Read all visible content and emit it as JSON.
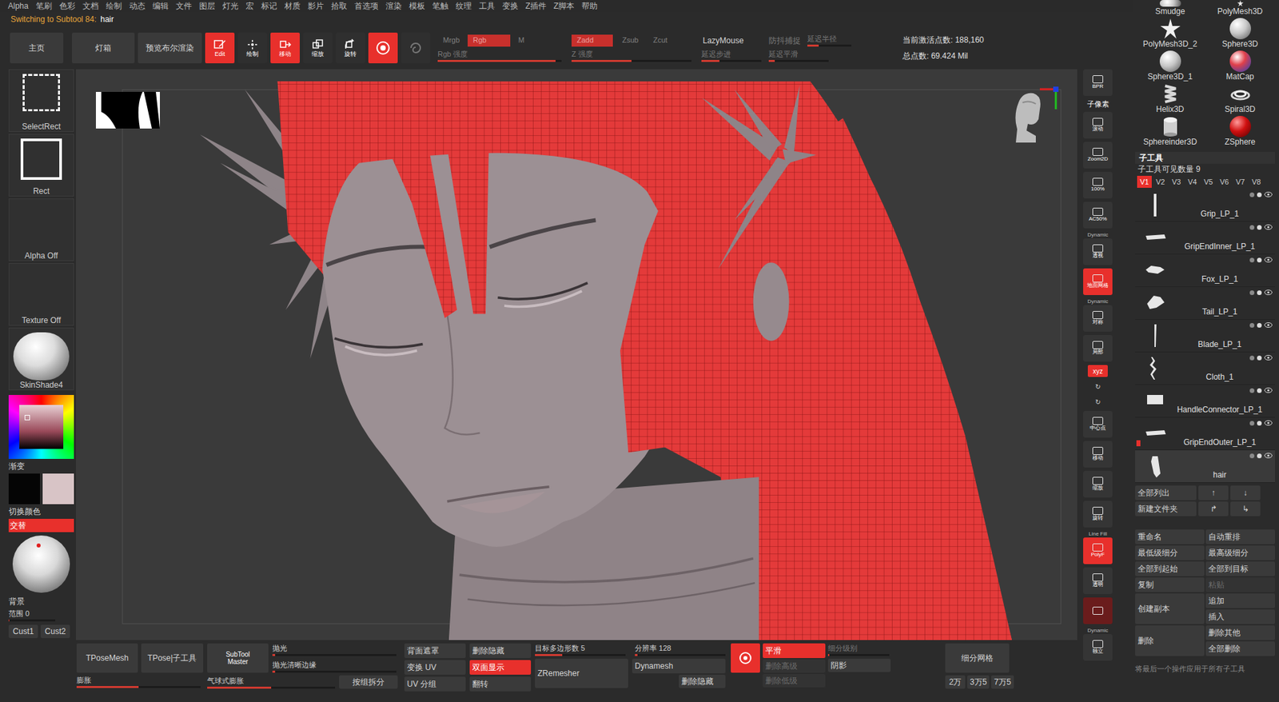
{
  "menu": [
    "Alpha",
    "笔刷",
    "色彩",
    "文档",
    "绘制",
    "动态",
    "编辑",
    "文件",
    "图层",
    "灯光",
    "宏",
    "标记",
    "材质",
    "影片",
    "拾取",
    "首选项",
    "渲染",
    "模板",
    "笔触",
    "纹理",
    "工具",
    "变换",
    "Z插件",
    "Z脚本",
    "帮助"
  ],
  "status": {
    "prefix": "Switching to Subtool 84:",
    "subtool": "hair"
  },
  "shelf": {
    "nav": [
      "主页",
      "灯箱",
      "预览布尔渲染"
    ],
    "modes": [
      {
        "label": "Edit",
        "kind": "edit",
        "selected": true
      },
      {
        "label": "绘制",
        "kind": "draw",
        "selected": false
      },
      {
        "label": "移动",
        "kind": "move",
        "selected": true
      },
      {
        "label": "缩放",
        "kind": "scale",
        "selected": false
      },
      {
        "label": "旋转",
        "kind": "rotate",
        "selected": false
      }
    ],
    "extras": [
      {
        "kind": "ring",
        "on": true
      },
      {
        "kind": "swirl",
        "on": false
      }
    ],
    "color_modes": [
      {
        "label": "Mrgb",
        "on": false
      },
      {
        "label": "Rgb",
        "on": true
      },
      {
        "label": "M",
        "on": false
      }
    ],
    "rgb_intensity": {
      "label": "Rgb 强度",
      "level": 0.95,
      "disabled": true
    },
    "z_modes": [
      {
        "label": "Zadd",
        "on": true
      },
      {
        "label": "Zsub",
        "on": false
      },
      {
        "label": "Zcut",
        "on": false
      }
    ],
    "z_intensity": {
      "label": "Z 强度",
      "level": 0.5,
      "disabled": true
    },
    "lazy": {
      "label": "LazyMouse",
      "on": false
    },
    "lazy_step": {
      "label": "延迟步进",
      "level": 0.3,
      "disabled": true
    },
    "snap": {
      "label": "防抖捕捉",
      "disabled": true
    },
    "lazy_radius": {
      "label": "延迟半径",
      "level": 0.25,
      "disabled": true
    },
    "lazy_smooth": {
      "label": "延迟平滑",
      "level": 0.1,
      "disabled": true
    },
    "active_points": "当前激活点数: 188,160",
    "total_points": "总点数: 69.424 Mil"
  },
  "left": {
    "tiles": [
      {
        "label": "SelectRect",
        "kind": "select"
      },
      {
        "label": "Rect",
        "kind": "rect"
      },
      {
        "label": "Alpha Off",
        "kind": "empty"
      },
      {
        "label": "Texture Off",
        "kind": "empty"
      },
      {
        "label": "SkinShade4",
        "kind": "material"
      }
    ],
    "gradient": "渐变",
    "swatches": [
      {
        "color": "#050505"
      },
      {
        "color": "#d8c4c6"
      }
    ],
    "switch": "切换颜色",
    "alternate": {
      "label": "交替",
      "on": true
    },
    "background": "背景",
    "range": {
      "label": "范围 0",
      "level": 0.0
    },
    "custom": [
      "Cust1",
      "Cust2"
    ]
  },
  "viewbar": [
    {
      "label": "BPR",
      "kind": "icon",
      "on": false
    },
    {
      "label": "子像素",
      "kind": "caption",
      "on": false
    },
    {
      "label": "滚动",
      "kind": "icon",
      "on": false
    },
    {
      "label": "Zoom2D",
      "kind": "icon",
      "on": false
    },
    {
      "label": "100%",
      "kind": "icon",
      "on": false
    },
    {
      "label": "AC50%",
      "kind": "icon",
      "on": false
    },
    {
      "label": "透视",
      "header": "Dynamic",
      "kind": "icon",
      "on": false
    },
    {
      "label": "地面网格",
      "kind": "icon",
      "on": true
    },
    {
      "label": "对称",
      "header": "Dynamic",
      "kind": "icon",
      "on": false
    },
    {
      "label": "局部",
      "kind": "icon",
      "on": false
    },
    {
      "label": "xyz",
      "kind": "small",
      "on": true
    },
    {
      "label": "↻",
      "kind": "small",
      "on": false
    },
    {
      "label": "↻",
      "kind": "small",
      "on": false
    },
    {
      "label": "中心点",
      "kind": "icon",
      "on": false
    },
    {
      "label": "移动",
      "kind": "icon",
      "on": false
    },
    {
      "label": "缩放",
      "kind": "icon",
      "on": false
    },
    {
      "label": "旋转",
      "kind": "icon",
      "on": false
    },
    {
      "label": "PolyF",
      "header": "Line Fill",
      "kind": "icon",
      "on": true
    },
    {
      "label": "透明",
      "kind": "icon",
      "on": false
    },
    {
      "kind": "ghost",
      "on": true
    },
    {
      "label": "独立",
      "header": "Dynamic",
      "kind": "icon",
      "on": false
    }
  ],
  "tools": [
    {
      "name": "Smudge",
      "kind": "smudge"
    },
    {
      "name": "PolyMesh3D",
      "kind": "star"
    },
    {
      "name": "PolyMesh3D_2",
      "kind": "star"
    },
    {
      "name": "Sphere3D",
      "kind": "sphere"
    },
    {
      "name": "Sphere3D_1",
      "kind": "sphere"
    },
    {
      "name": "MatCap",
      "kind": "matcap"
    },
    {
      "name": "Helix3D",
      "kind": "helix"
    },
    {
      "name": "Spiral3D",
      "kind": "spiral"
    },
    {
      "name": "Sphereinder3D",
      "kind": "cylinder"
    },
    {
      "name": "ZSphere",
      "kind": "zsphere"
    }
  ],
  "subtool": {
    "title": "子工具",
    "visible_count": "子工具可见数量 9",
    "versions": [
      {
        "label": "V1",
        "selected": true
      },
      {
        "label": "V2",
        "selected": false
      },
      {
        "label": "V3",
        "selected": false
      },
      {
        "label": "V4",
        "selected": false
      },
      {
        "label": "V5",
        "selected": false
      },
      {
        "label": "V6",
        "selected": false
      },
      {
        "label": "V7",
        "selected": false
      },
      {
        "label": "V8",
        "selected": false
      }
    ],
    "items": [
      {
        "name": "Grip_LP_1",
        "kind": "bar",
        "selected": false,
        "visible": true,
        "flag": false
      },
      {
        "name": "GripEndInner_LP_1",
        "kind": "flat",
        "selected": false,
        "visible": true,
        "flag": false
      },
      {
        "name": "Fox_LP_1",
        "kind": "fox",
        "selected": false,
        "visible": true,
        "flag": false
      },
      {
        "name": "Tail_LP_1",
        "kind": "tail",
        "selected": false,
        "visible": true,
        "flag": false
      },
      {
        "name": "Blade_LP_1",
        "kind": "blade",
        "selected": false,
        "visible": true,
        "flag": false
      },
      {
        "name": "Cloth_1",
        "kind": "cloth",
        "selected": false,
        "visible": true,
        "flag": false
      },
      {
        "name": "HandleConnector_LP_1",
        "kind": "handle",
        "selected": false,
        "visible": true,
        "flag": false
      },
      {
        "name": "GripEndOuter_LP_1",
        "kind": "flat",
        "selected": false,
        "visible": true,
        "flag": true
      },
      {
        "name": "hair",
        "kind": "hair",
        "selected": true,
        "visible": true,
        "flag": false
      }
    ],
    "list_all": "全部列出",
    "up": "↑",
    "down": "↓",
    "new_folder": "新建文件夹",
    "move_up": "↱",
    "move_down": "↳",
    "pairs": [
      [
        {
          "label": "重命名",
          "disabled": false
        },
        {
          "label": "自动重排",
          "disabled": false
        }
      ],
      [
        {
          "label": "最低级细分",
          "disabled": false
        },
        {
          "label": "最高级细分",
          "disabled": false
        }
      ],
      [
        {
          "label": "全部到起始",
          "disabled": false
        },
        {
          "label": "全部到目标",
          "disabled": false
        }
      ],
      [
        {
          "label": "复制",
          "disabled": false
        },
        {
          "label": "粘贴",
          "disabled": true
        }
      ]
    ],
    "duplicate": "创建副本",
    "append": "追加",
    "insert": "插入",
    "delete": "删除",
    "delete_other": "删除其他",
    "delete_all": "全部删除",
    "apply_all": "将最后一个操作应用于所有子工具"
  },
  "bottom": {
    "tpose": [
      "TPoseMesh",
      "TPose|子工具"
    ],
    "inflate": {
      "label": "膨胀",
      "level": 0.5
    },
    "subtool_master": [
      "SubTool",
      "Master"
    ],
    "polish": {
      "label": "抛光",
      "level": 0.02
    },
    "polish_edges": {
      "label": "抛光清晰边缘",
      "level": 0.02
    },
    "balloon": {
      "label": "气球式膨胀",
      "level": 0.5
    },
    "split": "按组拆分",
    "col3": [
      {
        "label": "背面遮罩",
        "on": false
      },
      {
        "label": "变换 UV",
        "on": false
      },
      {
        "label": "UV 分组",
        "on": false
      }
    ],
    "col4": [
      {
        "label": "删除隐藏",
        "on": false
      },
      {
        "label": "双面显示",
        "on": true
      },
      {
        "label": "翻转",
        "on": false
      }
    ],
    "target": {
      "label": "目标多边形数 5",
      "level": 0.3
    },
    "resolution": {
      "label": "分辨率 128",
      "level": 0.03
    },
    "zremesher": "ZRemesher",
    "dynamesh": "Dynamesh",
    "del_hidden": "删除隐藏",
    "dynamic_subdiv": {
      "on": true
    },
    "smooth": {
      "label": "平滑",
      "on": true
    },
    "del_higher": {
      "label": "删除高级",
      "disabled": true
    },
    "del_lower": {
      "label": "删除低级",
      "disabled": true
    },
    "subdiv": {
      "label": "细分级别",
      "level": 0.0,
      "disabled": true
    },
    "shadow": "阴影",
    "divide": "细分网格",
    "presets": [
      "2万",
      "3万5",
      "7万5"
    ]
  }
}
